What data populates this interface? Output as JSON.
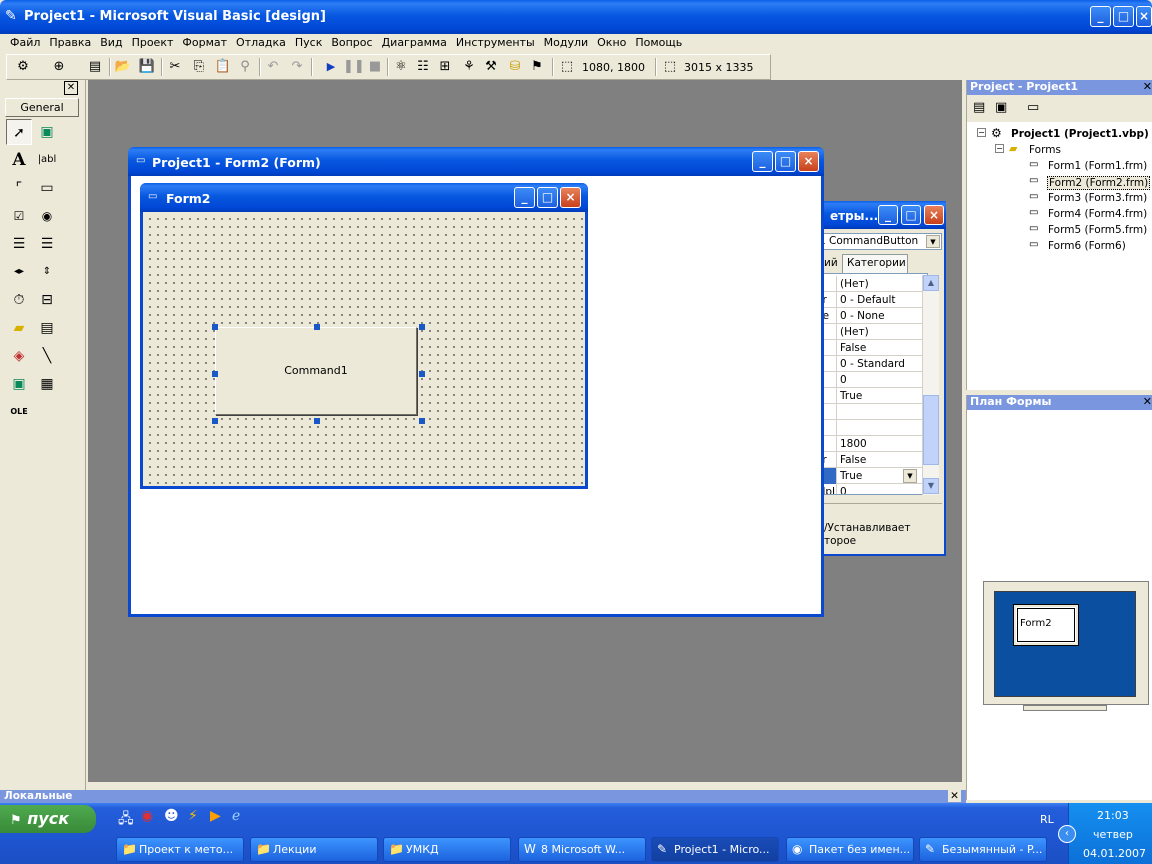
{
  "app": {
    "title": "Project1 - Microsoft Visual Basic [design]",
    "menu": [
      "Файл",
      "Правка",
      "Вид",
      "Проект",
      "Формат",
      "Отладка",
      "Пуск",
      "Вопрос",
      "Диаграмма",
      "Инструменты",
      "Модули",
      "Окно",
      "Помощь"
    ],
    "toolbar": {
      "position_readout": "1080, 1800",
      "size_readout": "3015 x 1335"
    }
  },
  "toolbox": {
    "tab": "General"
  },
  "form_designer": {
    "title": "Project1 - Form2 (Form)",
    "form_title": "Form2",
    "command_caption": "Command1"
  },
  "properties": {
    "title": "етры...",
    "object_select": "1  CommandButton",
    "tabs": [
      "ий",
      "Категории"
    ],
    "rows": [
      {
        "name": "",
        "value": "(Нет)"
      },
      {
        "name": "er",
        "value": "0 - Default"
      },
      {
        "name": "de",
        "value": "0 - None"
      },
      {
        "name": "",
        "value": "(Нет)"
      },
      {
        "name": "",
        "value": "False"
      },
      {
        "name": "",
        "value": "0 - Standard"
      },
      {
        "name": "",
        "value": "0"
      },
      {
        "name": "",
        "value": "True"
      },
      {
        "name": "",
        "value": ""
      },
      {
        "name": "",
        "value": ""
      },
      {
        "name": "",
        "value": "1800"
      },
      {
        "name": "or",
        "value": "False"
      },
      {
        "name": "",
        "value": "True"
      },
      {
        "name": "elpID",
        "value": "0"
      }
    ],
    "description_1": "/Устанавливает",
    "description_2": "торое"
  },
  "project_explorer": {
    "title": "Project - Project1",
    "root": "Project1 (Project1.vbp)",
    "folder": "Forms",
    "forms": [
      "Form1 (Form1.frm)",
      "Form2 (Form2.frm)",
      "Form3 (Form3.frm)",
      "Form4 (Form4.frm)",
      "Form5 (Form5.frm)",
      "Form6 (Form6)"
    ],
    "selected_index": 1
  },
  "form_layout": {
    "title": "План Формы",
    "preview_label": "Form2"
  },
  "bottom_panel": {
    "title": "Локальные"
  },
  "taskbar": {
    "start": "пуск",
    "tasks": [
      "Проект к мето...",
      "Лекции",
      "УМКД",
      "8 Microsoft W...",
      "Project1 - Micro...",
      "Пакет без имен...",
      "Безымянный - P..."
    ],
    "lang": "RL",
    "time": "21:03",
    "day": "четвер",
    "date": "04.01.2007"
  }
}
